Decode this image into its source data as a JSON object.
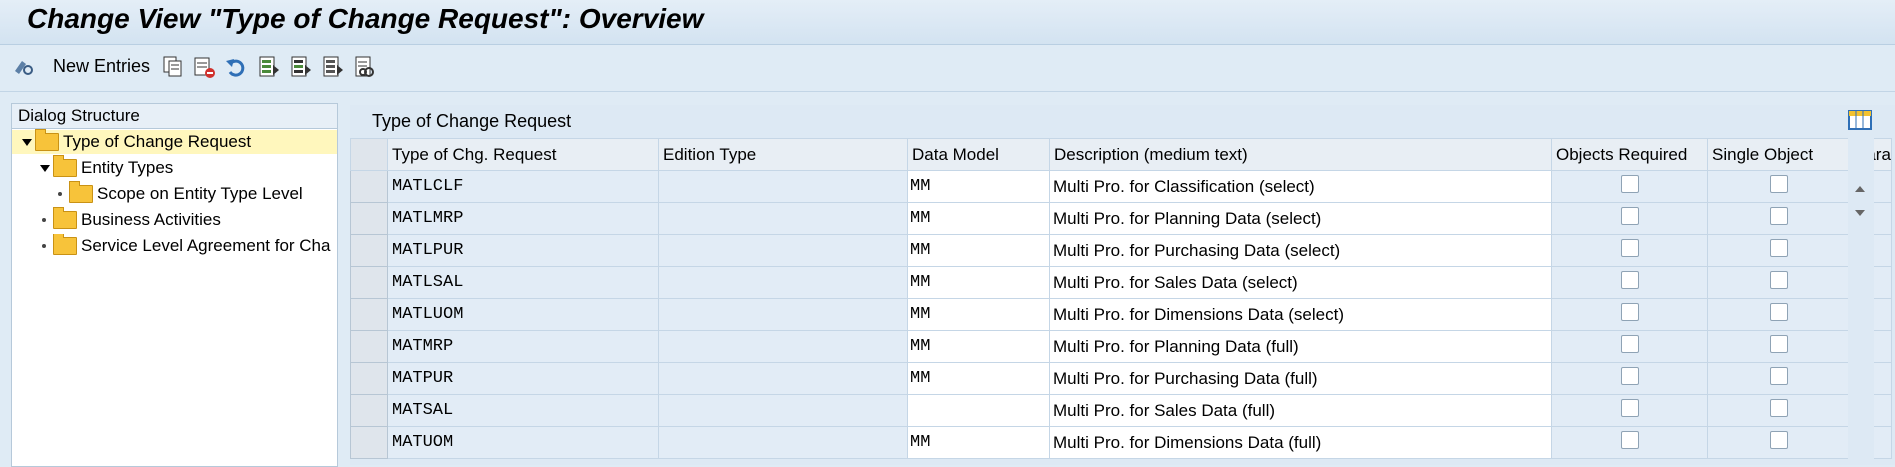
{
  "title": "Change View \"Type of Change Request\": Overview",
  "toolbar": {
    "new_entries_label": "New Entries",
    "icons": [
      "display-change-icon",
      "copy-icon",
      "delete-icon",
      "undo-icon",
      "select-all-icon",
      "select-block-icon",
      "deselect-all-icon",
      "print-icon"
    ]
  },
  "dialog": {
    "header": "Dialog Structure",
    "items": [
      {
        "label": "Type of Change Request"
      },
      {
        "label": "Entity Types"
      },
      {
        "label": "Scope on Entity Type Level"
      },
      {
        "label": "Business Activities"
      },
      {
        "label": "Service Level Agreement for Cha"
      }
    ]
  },
  "table": {
    "title": "Type of Change Request",
    "columns": [
      "Type of Chg. Request",
      "Edition Type",
      "Data Model",
      "Description (medium text)",
      "Objects Required",
      "Single Object",
      "Para"
    ],
    "rows": [
      {
        "type": "MATLCLF",
        "edition": "",
        "model": "MM",
        "desc": "Multi Pro. for Classification (select)"
      },
      {
        "type": "MATLMRP",
        "edition": "",
        "model": "MM",
        "desc": "Multi Pro. for Planning Data (select)"
      },
      {
        "type": "MATLPUR",
        "edition": "",
        "model": "MM",
        "desc": "Multi Pro. for Purchasing Data (select)"
      },
      {
        "type": "MATLSAL",
        "edition": "",
        "model": "MM",
        "desc": "Multi Pro. for Sales Data (select)"
      },
      {
        "type": "MATLUOM",
        "edition": "",
        "model": "MM",
        "desc": "Multi Pro. for Dimensions Data (select)"
      },
      {
        "type": "MATMRP",
        "edition": "",
        "model": "MM",
        "desc": "Multi Pro. for Planning Data (full)"
      },
      {
        "type": "MATPUR",
        "edition": "",
        "model": "MM",
        "desc": "Multi Pro. for Purchasing Data (full)"
      },
      {
        "type": "MATSAL",
        "edition": "",
        "model": "",
        "desc": "Multi Pro. for Sales Data (full)"
      },
      {
        "type": "MATUOM",
        "edition": "",
        "model": "MM",
        "desc": "Multi Pro. for Dimensions Data (full)"
      }
    ]
  }
}
